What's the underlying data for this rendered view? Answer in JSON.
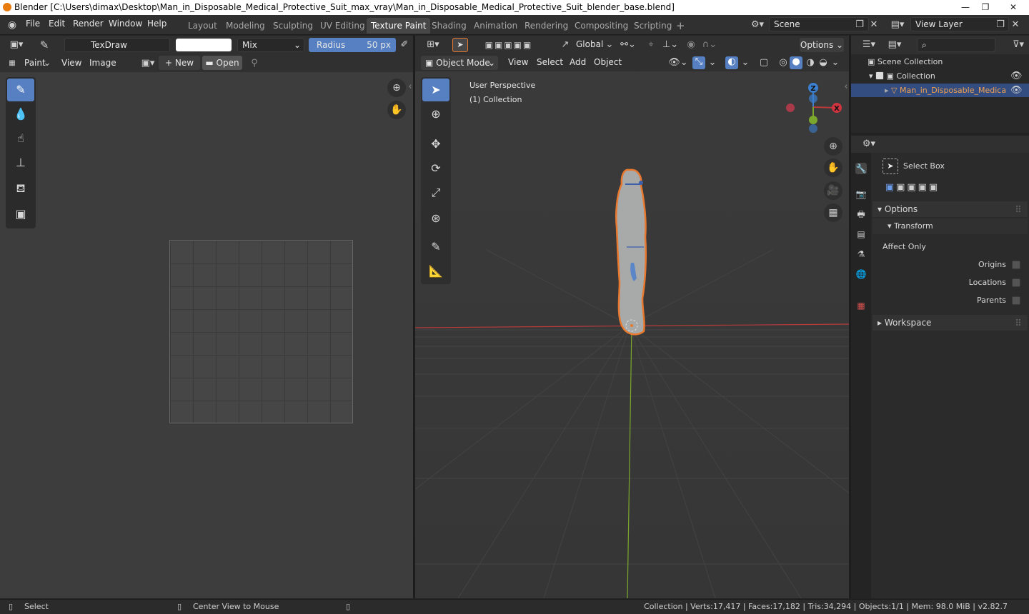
{
  "window": {
    "title": "Blender [C:\\Users\\dimax\\Desktop\\Man_in_Disposable_Medical_Protective_Suit_max_vray\\Man_in_Disposable_Medical_Protective_Suit_blender_base.blend]",
    "minimize": "—",
    "restore": "❐",
    "close": "✕"
  },
  "menu": [
    "File",
    "Edit",
    "Render",
    "Window",
    "Help"
  ],
  "workspaces": [
    "Layout",
    "Modeling",
    "Sculpting",
    "UV Editing",
    "Texture Paint",
    "Shading",
    "Animation",
    "Rendering",
    "Compositing",
    "Scripting",
    "+"
  ],
  "active_workspace": "Texture Paint",
  "scene": {
    "name": "Scene",
    "view_layer": "View Layer"
  },
  "image_editor": {
    "brush_name": "TexDraw",
    "blend_mode": "Mix",
    "radius_label": "Radius",
    "radius_value": "50 px",
    "mode": "Paint",
    "menu": [
      "View",
      "Image"
    ],
    "new_label": "New",
    "open_label": "Open",
    "brush_color": "#ffffff"
  },
  "viewport": {
    "mode": "Object Mode",
    "menu": [
      "View",
      "Select",
      "Add",
      "Object"
    ],
    "transform_orientation": "Global",
    "options_label": "Options",
    "overlay_line1": "User Perspective",
    "overlay_line2": "(1) Collection",
    "gizmo": {
      "z": "Z",
      "x": "X"
    }
  },
  "outliner": {
    "root": "Scene Collection",
    "collection": "Collection",
    "object": "Man_in_Disposable_Medica"
  },
  "properties": {
    "tool_name": "Select Box",
    "options_label": "Options",
    "transform_label": "Transform",
    "affect_only_label": "Affect Only",
    "checkboxes": [
      {
        "label": "Origins",
        "checked": false
      },
      {
        "label": "Locations",
        "checked": false
      },
      {
        "label": "Parents",
        "checked": false
      }
    ],
    "workspace_label": "Workspace"
  },
  "status": {
    "left_action": "Select",
    "middle_action": "Center View to Mouse",
    "stats": "Collection | Verts:17,417 | Faces:17,182 | Tris:34,294 | Objects:1/1 | Mem: 98.0 MiB | v2.82.7"
  },
  "colors": {
    "accent": "#5680c2",
    "selection_outline": "#e8782e",
    "x_axis": "#b83a3a",
    "y_axis": "#7ba82c",
    "z_axis": "#3b7fd0"
  }
}
